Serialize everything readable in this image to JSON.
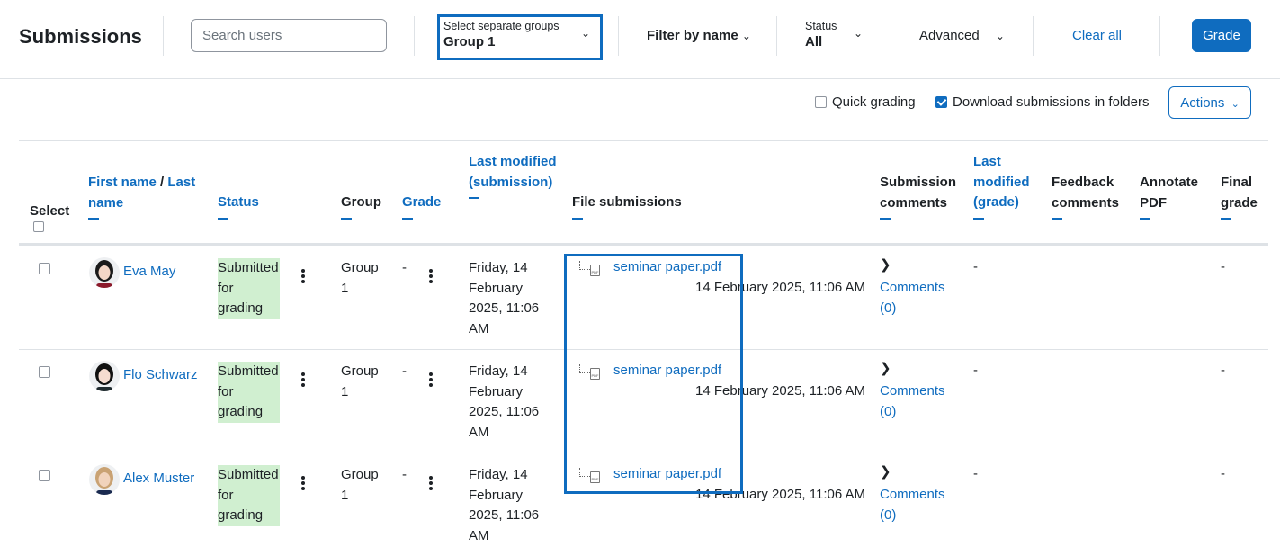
{
  "header": {
    "title": "Submissions",
    "search_placeholder": "Search users",
    "group_select": {
      "label": "Select separate groups",
      "value": "Group 1"
    },
    "filter_by_name": "Filter by name",
    "status_select": {
      "label": "Status",
      "value": "All"
    },
    "advanced": "Advanced",
    "clear_all": "Clear all",
    "grade_button": "Grade"
  },
  "toolbar": {
    "quick_grading": {
      "label": "Quick grading",
      "checked": false
    },
    "download_in_folders": {
      "label": "Download submissions in folders",
      "checked": true
    },
    "actions": "Actions"
  },
  "icons": {
    "chevron_down": "⌄",
    "chevron_right": "›",
    "kebab": "⋮",
    "file": "pdf-file-icon",
    "accent": "#0f6cbf",
    "status_bg": "#d0efd0"
  },
  "table": {
    "columns": {
      "select": "Select",
      "first_name": "First name",
      "name_sep": " / ",
      "last_name": "Last name",
      "status": "Status",
      "group": "Group",
      "grade": "Grade",
      "last_modified_submission": "Last modified (submission)",
      "file_submissions": "File submissions",
      "submission_comments": "Submission comments",
      "last_modified_grade": "Last modified (grade)",
      "feedback_comments": "Feedback comments",
      "annotate_pdf": "Annotate PDF",
      "final_grade": "Final grade"
    },
    "rows": [
      {
        "name": "Eva May",
        "status": "Submitted for grading",
        "group": "Group 1",
        "grade": "-",
        "last_modified_submission": "Friday, 14 February 2025, 11:06 AM",
        "file_name": "seminar paper.pdf",
        "file_date": "14 February 2025, 11:06 AM",
        "comments": "Comments (0)",
        "last_modified_grade": "-",
        "final_grade": "-"
      },
      {
        "name": "Flo Schwarz",
        "status": "Submitted for grading",
        "group": "Group 1",
        "grade": "-",
        "last_modified_submission": "Friday, 14 February 2025, 11:06 AM",
        "file_name": "seminar paper.pdf",
        "file_date": "14 February 2025, 11:06 AM",
        "comments": "Comments (0)",
        "last_modified_grade": "-",
        "final_grade": "-"
      },
      {
        "name": "Alex Muster",
        "status": "Submitted for grading",
        "group": "Group 1",
        "grade": "-",
        "last_modified_submission": "Friday, 14 February 2025, 11:06 AM",
        "file_name": "seminar paper.pdf",
        "file_date": "14 February 2025, 11:06 AM",
        "comments": "Comments (0)",
        "last_modified_grade": "-",
        "final_grade": "-"
      }
    ]
  }
}
